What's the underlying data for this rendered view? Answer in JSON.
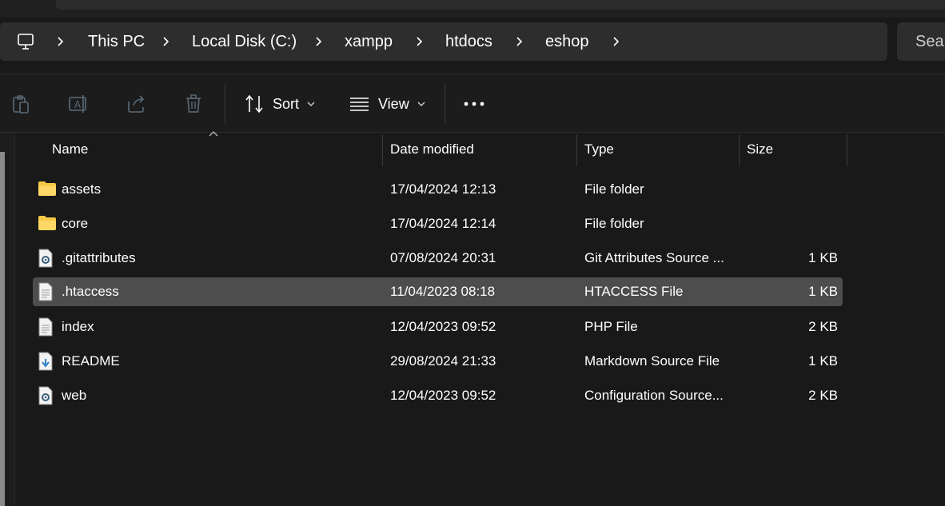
{
  "address_bar": {
    "breadcrumbs": [
      "This PC",
      "Local Disk (C:)",
      "xampp",
      "htdocs",
      "eshop"
    ]
  },
  "search": {
    "placeholder": "Sear"
  },
  "command_bar": {
    "sort_label": "Sort",
    "view_label": "View"
  },
  "columns": {
    "name": "Name",
    "date": "Date modified",
    "type": "Type",
    "size": "Size"
  },
  "files": [
    {
      "name": "assets",
      "date": "17/04/2024 12:13",
      "type": "File folder",
      "size": "",
      "icon": "folder-icon"
    },
    {
      "name": "core",
      "date": "17/04/2024 12:14",
      "type": "File folder",
      "size": "",
      "icon": "folder-icon"
    },
    {
      "name": ".gitattributes",
      "date": "07/08/2024 20:31",
      "type": "Git Attributes Source ...",
      "size": "1 KB",
      "icon": "settings-file-icon"
    },
    {
      "name": ".htaccess",
      "date": "11/04/2023 08:18",
      "type": "HTACCESS File",
      "size": "1 KB",
      "icon": "text-file-icon",
      "selected": true
    },
    {
      "name": "index",
      "date": "12/04/2023 09:52",
      "type": "PHP File",
      "size": "2 KB",
      "icon": "text-file-icon"
    },
    {
      "name": "README",
      "date": "29/08/2024 21:33",
      "type": "Markdown Source File",
      "size": "1 KB",
      "icon": "markdown-file-icon"
    },
    {
      "name": "web",
      "date": "12/04/2023 09:52",
      "type": "Configuration Source...",
      "size": "2 KB",
      "icon": "settings-file-icon"
    }
  ],
  "colors": {
    "background": "#191919",
    "selected_row": "#4d4d4d",
    "folder": "#f7c948"
  }
}
